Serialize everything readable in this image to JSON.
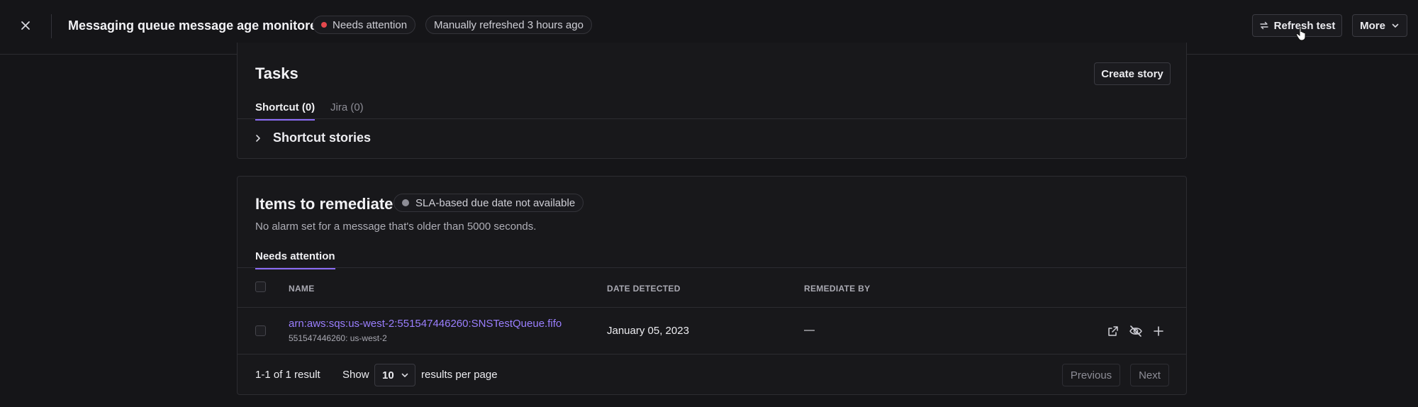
{
  "header": {
    "title": "Messaging queue message age monitored",
    "status_label": "Needs attention",
    "refresh_status": "Manually refreshed 3 hours ago",
    "refresh_button": "Refresh test",
    "more_button": "More"
  },
  "tasks": {
    "title": "Tasks",
    "create_story": "Create story",
    "tabs": [
      {
        "label": "Shortcut (0)",
        "active": true
      },
      {
        "label": "Jira (0)",
        "active": false
      }
    ],
    "section_label": "Shortcut stories"
  },
  "remediate": {
    "title": "Items to remediate",
    "sla_badge": "SLA-based due date not available",
    "description": "No alarm set for a message that's older than 5000 seconds.",
    "tab": "Needs attention",
    "columns": [
      "NAME",
      "DATE DETECTED",
      "REMEDIATE BY"
    ],
    "rows": [
      {
        "name": "arn:aws:sqs:us-west-2:551547446260:SNSTestQueue.fifo",
        "sub": "551547446260: us-west-2",
        "date_detected": "January 05, 2023",
        "remediate_by": "—"
      }
    ],
    "pagination": {
      "summary": "1-1 of 1 result",
      "show_label": "Show",
      "per_page_value": "10",
      "per_page_suffix": "results per page",
      "previous": "Previous",
      "next": "Next"
    }
  },
  "colors": {
    "accent": "#8b6cf6",
    "link": "#9b7fff",
    "danger": "#e5484d",
    "background": "#151518"
  }
}
